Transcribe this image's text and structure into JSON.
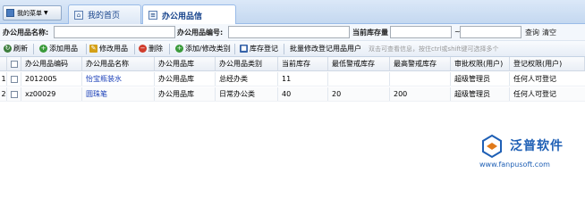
{
  "menu": {
    "label": "我的菜单"
  },
  "tabs": [
    {
      "label": "我的首页"
    },
    {
      "label": "办公用品信"
    }
  ],
  "filters": {
    "name_label": "办公用品名称:",
    "code_label": "办公用品编号:",
    "stock_label": "当前库存量",
    "range_sep": "~",
    "query": "查询",
    "clear": "清空"
  },
  "toolbar": {
    "refresh": "刷新",
    "add": "添加用品",
    "edit": "修改用品",
    "delete": "删除",
    "add_modify_category": "添加/修改类别",
    "stock_register": "库存登记",
    "batch_modify": "批量修改登记用品用户",
    "hint": "双击可查看信息，按住ctrl或shift键可选择多个"
  },
  "table": {
    "headers": [
      "办公用品编码",
      "办公用品名称",
      "办公用品库",
      "办公用品类别",
      "当前库存",
      "最低警戒库存",
      "最高警戒库存",
      "审批权限(用户)",
      "登记权限(用户)"
    ],
    "rows": [
      {
        "no": "1",
        "code": "2012005",
        "name": "怡宝瓶装水",
        "store": "办公用品库",
        "category": "总经办类",
        "stock": "11",
        "min": "",
        "max": "",
        "approve": "超级管理员",
        "register": "任何人可登记"
      },
      {
        "no": "2",
        "code": "xz00029",
        "name": "圆珠笔",
        "store": "办公用品库",
        "category": "日常办公类",
        "stock": "40",
        "min": "20",
        "max": "200",
        "approve": "超级管理员",
        "register": "任何人可登记"
      }
    ]
  },
  "logo": {
    "name": "泛普软件",
    "url": "www.fanpusoft.com"
  },
  "colors": {
    "accent": "#15428b",
    "link": "#1a3fb8",
    "brand": "#1e5fb5"
  }
}
